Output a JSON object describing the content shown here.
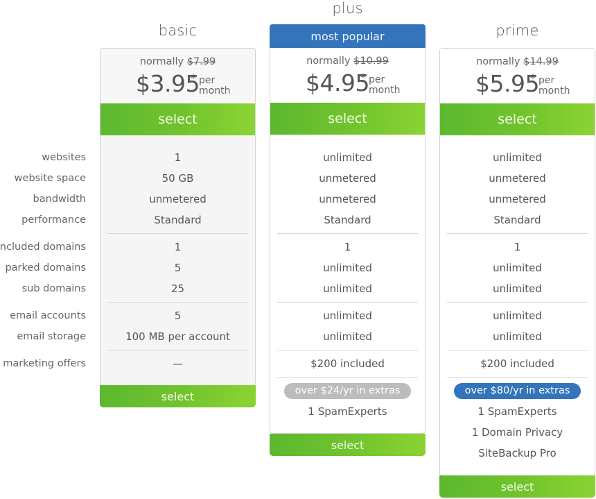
{
  "feature_labels": [
    "websites",
    "website space",
    "bandwidth",
    "performance",
    "included domains",
    "parked domains",
    "sub domains",
    "email accounts",
    "email storage",
    "marketing offers"
  ],
  "plans": [
    {
      "name": "basic",
      "badge": null,
      "normally_label": "normally",
      "old_price": "$7.99",
      "price": "$3.95",
      "asterisk": "*",
      "per": "per",
      "period": "month",
      "select_label": "select",
      "features": [
        "1",
        "50 GB",
        "unmetered",
        "Standard",
        "1",
        "5",
        "25",
        "5",
        "100 MB per account",
        "—"
      ],
      "extras_pill": null,
      "extras": [],
      "bottom_select_label": "select"
    },
    {
      "name": "plus",
      "badge": "most popular",
      "normally_label": "normally",
      "old_price": "$10.99",
      "price": "$4.95",
      "asterisk": "*",
      "per": "per",
      "period": "month",
      "select_label": "select",
      "features": [
        "unlimited",
        "unmetered",
        "unmetered",
        "Standard",
        "1",
        "unlimited",
        "unlimited",
        "unlimited",
        "unlimited",
        "$200 included"
      ],
      "extras_pill": "over $24/yr in extras",
      "extras": [
        "1 SpamExperts"
      ],
      "bottom_select_label": "select"
    },
    {
      "name": "prime",
      "badge": null,
      "normally_label": "normally",
      "old_price": "$14.99",
      "price": "$5.95",
      "asterisk": "*",
      "per": "per",
      "period": "month",
      "select_label": "select",
      "features": [
        "unlimited",
        "unmetered",
        "unmetered",
        "Standard",
        "1",
        "unlimited",
        "unlimited",
        "unlimited",
        "unlimited",
        "$200 included"
      ],
      "extras_pill": "over $80/yr in extras",
      "extras": [
        "1 SpamExperts",
        "1 Domain Privacy",
        "SiteBackup Pro"
      ],
      "bottom_select_label": "select"
    }
  ],
  "colors": {
    "select_green": "#72c42e",
    "popular_blue": "#3474bb",
    "pill_gray": "#bcbcbc"
  }
}
